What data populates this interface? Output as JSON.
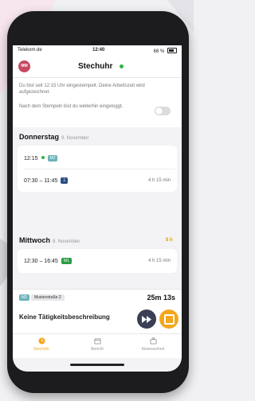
{
  "status": {
    "carrier": "Telekom.de",
    "time": "12:40",
    "battery": "68 %"
  },
  "header": {
    "avatar": "MM",
    "title": "Stechuhr"
  },
  "info": {
    "clocked_in_text": "Du bist seit 12:15 Uhr eingestempelt. Deine Arbeitszeit wird aufgezeichnet.",
    "toggle_text": "Nach dem Stempeln bist du weiterhin eingeloggt."
  },
  "days": [
    {
      "name": "Donnerstag",
      "date": "9. November",
      "total": "",
      "entries": [
        {
          "time": "12:15",
          "tag": "M2",
          "duration": ""
        },
        {
          "time": "07:30 – 11:45",
          "tag": "1",
          "duration": "4 h 15 min"
        }
      ]
    },
    {
      "name": "Mittwoch",
      "date": "8. November",
      "total": "8 h",
      "entries": [
        {
          "time": "12:30 – 16:45",
          "tag": "M1",
          "duration": "4 h 15 min"
        }
      ]
    }
  ],
  "active": {
    "tag": "M2",
    "address": "Musterstraße 2",
    "timer": "25m 13s",
    "activity": "Keine Tätigkeitsbeschreibung"
  },
  "tabs": [
    {
      "label": "Stechuhr",
      "icon": "clock-icon"
    },
    {
      "label": "Bericht",
      "icon": "calendar-icon"
    },
    {
      "label": "Abwesenheit",
      "icon": "suitcase-icon"
    }
  ],
  "colors": {
    "accent": "#f4a71c",
    "active_dot": "#2fb34a",
    "tag_teal": "#6bb3b9",
    "tag_blue": "#2a4f86",
    "tag_green": "#2a9c45"
  }
}
